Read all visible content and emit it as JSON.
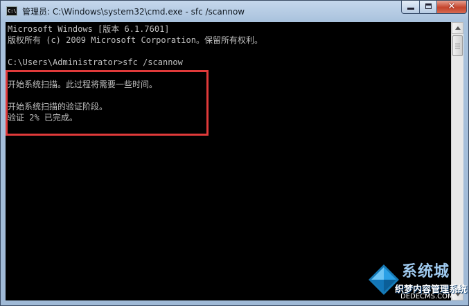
{
  "window": {
    "title": "管理员: C:\\Windows\\system32\\cmd.exe - sfc  /scannow",
    "app_icon_text": "C:\\",
    "close_glyph": "✕"
  },
  "console": {
    "lines": [
      "Microsoft Windows [版本 6.1.7601]",
      "版权所有 (c) 2009 Microsoft Corporation。保留所有权利。",
      "",
      "C:\\Users\\Administrator>sfc /scannow",
      "",
      "开始系统扫描。此过程将需要一些时间。",
      "",
      "开始系统扫描的验证阶段。",
      "验证 2% 已完成。"
    ]
  },
  "watermark": {
    "title": "系统城",
    "site": "织梦内容管理系统",
    "url": "DEDECMS.COM"
  },
  "colors": {
    "console_bg": "#000000",
    "console_text": "#c0c0c0",
    "highlight_border": "#e03a3a",
    "close_button": "#c4432b"
  }
}
